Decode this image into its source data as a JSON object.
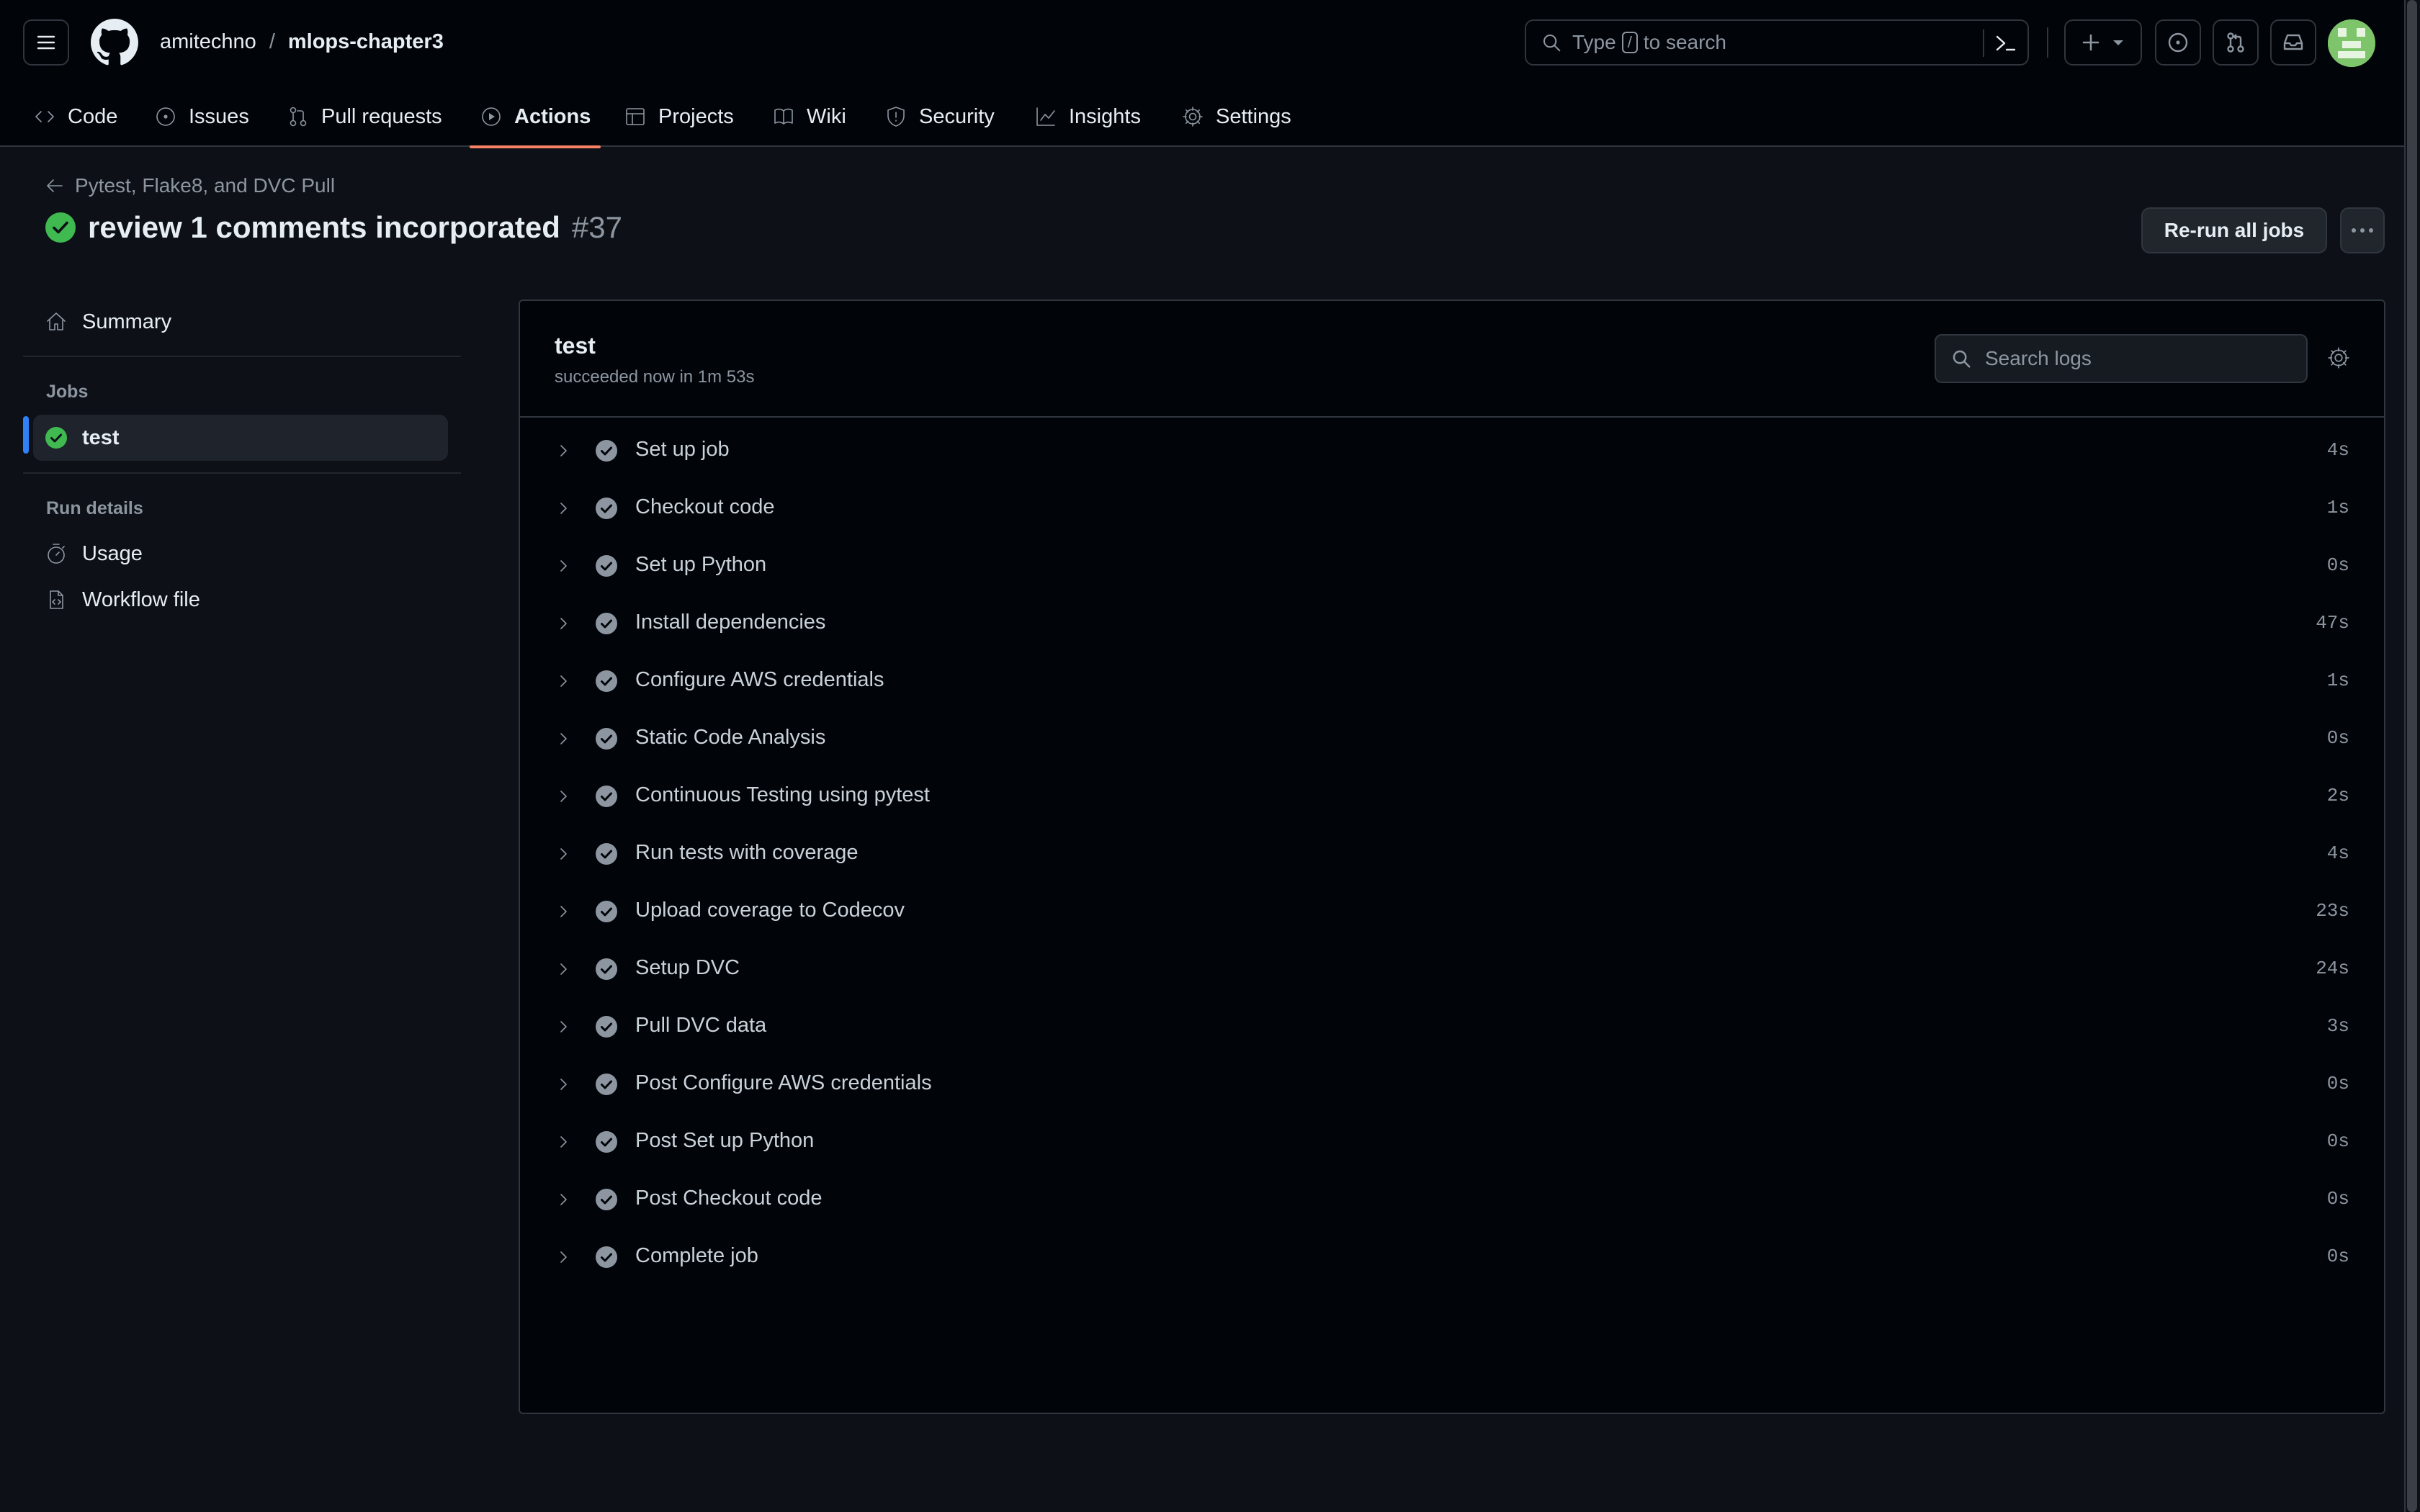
{
  "header": {
    "owner": "amitechno",
    "separator": "/",
    "repo": "mlops-chapter3",
    "search_prefix": "Type",
    "search_key": "/",
    "search_suffix": "to search"
  },
  "nav": {
    "tabs": [
      {
        "label": "Code",
        "icon": "code-icon"
      },
      {
        "label": "Issues",
        "icon": "issue-icon"
      },
      {
        "label": "Pull requests",
        "icon": "pull-request-icon"
      },
      {
        "label": "Actions",
        "icon": "play-icon",
        "active": true
      },
      {
        "label": "Projects",
        "icon": "table-icon"
      },
      {
        "label": "Wiki",
        "icon": "book-icon"
      },
      {
        "label": "Security",
        "icon": "shield-icon"
      },
      {
        "label": "Insights",
        "icon": "graph-icon"
      },
      {
        "label": "Settings",
        "icon": "gear-icon"
      }
    ]
  },
  "run": {
    "workflow_name": "Pytest, Flake8, and DVC Pull",
    "title": "review 1 comments incorporated",
    "number": "#37",
    "rerun_label": "Re-run all jobs"
  },
  "sidebar": {
    "summary_label": "Summary",
    "jobs_heading": "Jobs",
    "job_label": "test",
    "run_details_heading": "Run details",
    "usage_label": "Usage",
    "workflow_file_label": "Workflow file"
  },
  "job": {
    "name": "test",
    "status": "succeeded now in 1m 53s",
    "search_placeholder": "Search logs",
    "steps": [
      {
        "name": "Set up job",
        "duration": "4s"
      },
      {
        "name": "Checkout code",
        "duration": "1s"
      },
      {
        "name": "Set up Python",
        "duration": "0s"
      },
      {
        "name": "Install dependencies",
        "duration": "47s"
      },
      {
        "name": "Configure AWS credentials",
        "duration": "1s"
      },
      {
        "name": "Static Code Analysis",
        "duration": "0s"
      },
      {
        "name": "Continuous Testing using pytest",
        "duration": "2s"
      },
      {
        "name": "Run tests with coverage",
        "duration": "4s"
      },
      {
        "name": "Upload coverage to Codecov",
        "duration": "23s"
      },
      {
        "name": "Setup DVC",
        "duration": "24s"
      },
      {
        "name": "Pull DVC data",
        "duration": "3s"
      },
      {
        "name": "Post Configure AWS credentials",
        "duration": "0s"
      },
      {
        "name": "Post Set up Python",
        "duration": "0s"
      },
      {
        "name": "Post Checkout code",
        "duration": "0s"
      },
      {
        "name": "Complete job",
        "duration": "0s"
      }
    ]
  },
  "colors": {
    "success": "#3fb950",
    "accent_underline": "#f78166",
    "selection_indicator": "#2f81f7",
    "background": "#0d1117"
  }
}
